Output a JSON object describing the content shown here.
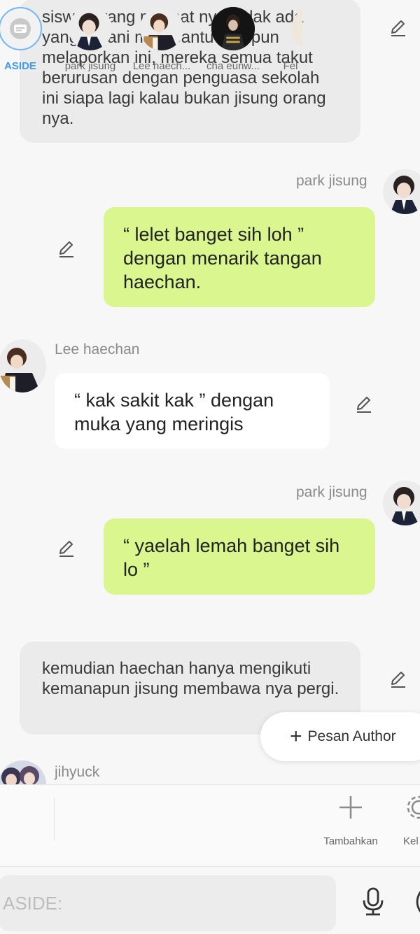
{
  "messages": [
    {
      "type": "narration",
      "text": "siswa ² yang melihat nya.  tidak ada yang berani membantu  maupun melaporkan ini, mereka  semua takut berurusan dengan penguasa sekolah ini siapa lagi kalau bukan jisung orang nya."
    },
    {
      "type": "chat",
      "side": "right",
      "name": "park jisung",
      "text": "“ lelet banget sih loh ” dengan menarik tangan haechan."
    },
    {
      "type": "chat",
      "side": "left",
      "name": "Lee haechan",
      "text": "“ kak sakit kak ” dengan muka yang meringis"
    },
    {
      "type": "chat",
      "side": "right",
      "name": "park jisung",
      "text": "“  yaelah lemah banget sih lo ”"
    },
    {
      "type": "narration",
      "text": "kemudian haechan hanya mengikuti kemanapun jisung membawa nya pergi."
    },
    {
      "type": "chat",
      "side": "left",
      "name": "jihyuck",
      "text": ""
    }
  ],
  "pesan_author": {
    "label": "Pesan Author",
    "icon": "plus-icon"
  },
  "characters": [
    {
      "label": "ASIDE",
      "icon": "aside-icon"
    },
    {
      "label": "park jisung"
    },
    {
      "label": "Lee haech..."
    },
    {
      "label": "cha eunw..."
    },
    {
      "label": "Fel"
    }
  ],
  "actions": {
    "add_label": "Tambahkan",
    "settings_label": "Kel"
  },
  "input": {
    "placeholder": "ASIDE:"
  },
  "colors": {
    "right_bubble": "#d9f68f",
    "left_bubble": "#ffffff",
    "narration_bubble": "#ebebeb",
    "accent": "#3d9cf0"
  }
}
